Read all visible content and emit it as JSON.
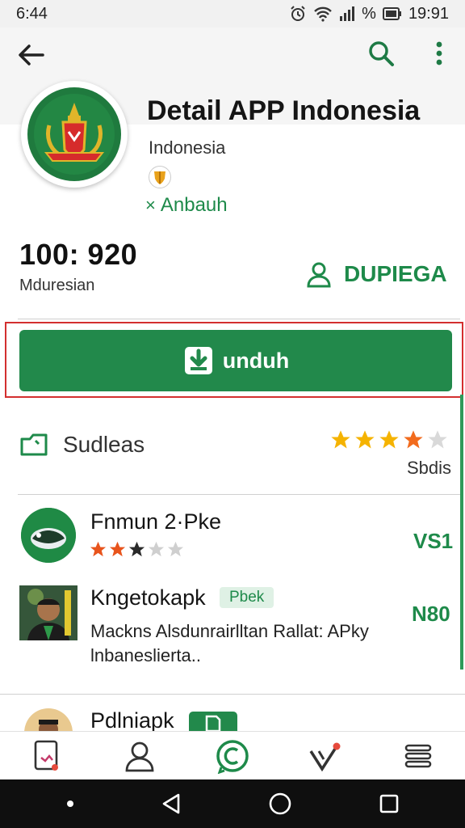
{
  "status_bar": {
    "time_left": "6:44",
    "battery_text": "%",
    "time_right": "19:91"
  },
  "app": {
    "title": "Detail APP Indonesia",
    "developer": "Indonesia",
    "install_status": "Anbauh",
    "install_status_icon": "x-icon"
  },
  "stats": {
    "downloads_value": "100: 920",
    "downloads_label": "Mduresian",
    "developer_link": "DUPIEGA"
  },
  "download_button": {
    "label": "unduh"
  },
  "reviews": {
    "title": "Sudleas",
    "subtitle": "Sbdis",
    "rating": 4
  },
  "list": [
    {
      "title": "Fnmun 2·Pke",
      "value": "VS1",
      "rating": 2.5
    },
    {
      "title": "Kngetokapk",
      "tag": "Pbek",
      "value": "N80",
      "description_line1": "Mackns Alsdunrairlltan Rallat: APky",
      "description_line2": "lnbaneslierta.."
    },
    {
      "title": "Pdlniapk"
    }
  ],
  "colors": {
    "brand_green": "#22894b",
    "accent_green": "#1e8a4a",
    "highlight_red": "#d32f2f",
    "star_yellow": "#f5b301",
    "star_orange": "#f26b1d"
  }
}
